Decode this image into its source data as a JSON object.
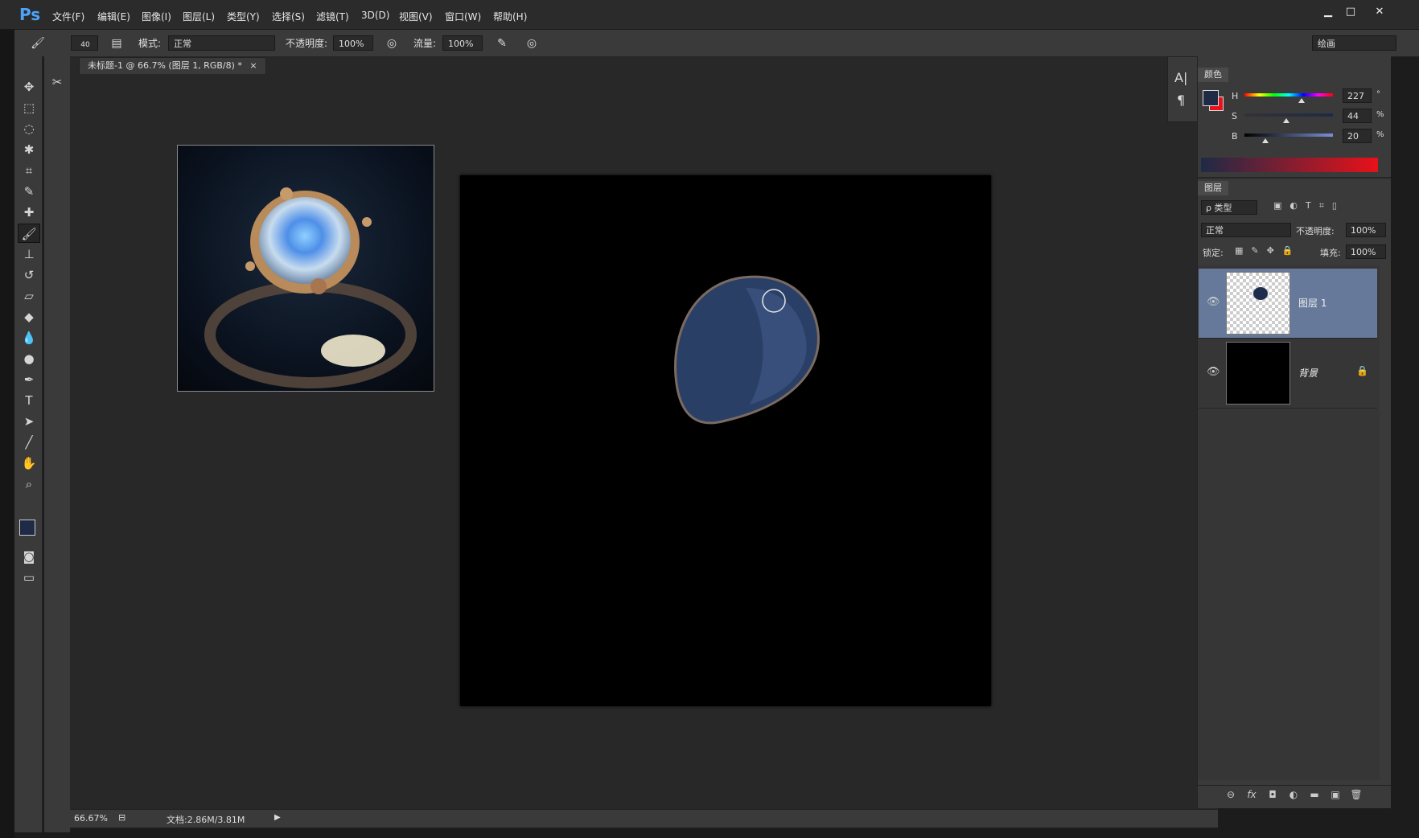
{
  "app": {
    "logo": "Ps"
  },
  "menu": [
    "文件(F)",
    "编辑(E)",
    "图像(I)",
    "图层(L)",
    "类型(Y)",
    "选择(S)",
    "滤镜(T)",
    "3D(D)",
    "视图(V)",
    "窗口(W)",
    "帮助(H)"
  ],
  "window_controls": {
    "minimize": "▁",
    "maximize": "□",
    "close": "✕"
  },
  "options": {
    "brush_size": "40",
    "mode_label": "模式:",
    "mode_value": "正常",
    "opacity_label": "不透明度:",
    "opacity_value": "100%",
    "flow_label": "流量:",
    "flow_value": "100%",
    "workspace": "绘画"
  },
  "document": {
    "tab_title": "未标题-1 @ 66.7% (图层 1, RGB/8) *",
    "tab_close": "×"
  },
  "status": {
    "zoom": "66.67%",
    "doc_size": "文档:2.86M/3.81M"
  },
  "color_panel": {
    "tab": "颜色",
    "h_label": "H",
    "h_value": "227",
    "h_unit": "°",
    "s_label": "S",
    "s_value": "44",
    "s_unit": "%",
    "b_label": "B",
    "b_value": "20",
    "b_unit": "%",
    "foreground": "#1e2a46",
    "background": "#e8111a"
  },
  "layers_panel": {
    "tab": "图层",
    "filter": "ρ 类型",
    "blend": "正常",
    "opacity_label": "不透明度:",
    "opacity_value": "100%",
    "lock_label": "锁定:",
    "fill_label": "填充:",
    "fill_value": "100%",
    "layers": [
      {
        "name": "图层 1",
        "selected": true
      },
      {
        "name": "背景",
        "selected": false
      }
    ]
  },
  "tools": [
    "move-tool-icon",
    "marquee-tool-icon",
    "lasso-tool-icon",
    "magic-wand-icon",
    "crop-tool-icon",
    "eyedropper-icon",
    "healing-brush-icon",
    "brush-tool-icon",
    "clone-stamp-icon",
    "history-brush-icon",
    "eraser-icon",
    "paint-bucket-icon",
    "blur-tool-icon",
    "dodge-tool-icon",
    "pen-tool-icon",
    "type-tool-icon",
    "path-selection-icon",
    "line-tool-icon",
    "hand-tool-icon",
    "zoom-tool-icon"
  ]
}
